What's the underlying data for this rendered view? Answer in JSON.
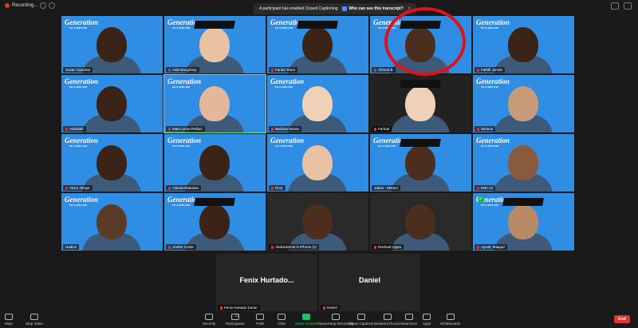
{
  "topbar": {
    "recording_label": "Recording...",
    "notice_text": "A participant has enabled Closed Captioning",
    "notice_link": "Who can see this transcript?"
  },
  "tiles": [
    {
      "name": "Susan Oyedran",
      "mic": false
    },
    {
      "name": "Aida Baugharty",
      "mic": true
    },
    {
      "name": "Farida Toure",
      "mic": true
    },
    {
      "name": "Ahmed B",
      "mic": true
    },
    {
      "name": "Fathifi Jumah",
      "mic": true
    },
    {
      "name": "Abdullah",
      "mic": true
    },
    {
      "name": "Matt Lucas Perfect",
      "mic": true
    },
    {
      "name": "Barbara Moore",
      "mic": true
    },
    {
      "name": "Farhad",
      "mic": true
    },
    {
      "name": "Simeon",
      "mic": true
    },
    {
      "name": "Victor Okoye",
      "mic": true
    },
    {
      "name": "Adeola Babalola",
      "mic": true
    },
    {
      "name": "Rory",
      "mic": true
    },
    {
      "name": "Jabari - Mentor",
      "mic": false
    },
    {
      "name": "Moh Ali",
      "mic": true
    },
    {
      "name": "Hadiza",
      "mic": false
    },
    {
      "name": "Jenifer Corke",
      "mic": true
    },
    {
      "name": "Abdulrahman's iPhone (2)",
      "mic": true
    },
    {
      "name": "Racheal Ugwu",
      "mic": true
    },
    {
      "name": "Ayoub Telaqud",
      "mic": true
    }
  ],
  "logo": {
    "main": "Generation",
    "sub": "UK & IRELAND"
  },
  "big_tiles": [
    {
      "display": "Fenix Hurtado...",
      "name": "Fenix Hurtado Duran"
    },
    {
      "display": "Daniel",
      "name": "Daniel"
    }
  ],
  "toolbar": {
    "mute": "Mute",
    "stop_video": "Stop Video",
    "security": "Security",
    "participants": "Participants",
    "participants_count": "22",
    "polls": "Polls",
    "chat": "Chat",
    "share_screen": "Share Screen",
    "pause_recording": "Pause/Stop Recording",
    "show_captions": "Show Captions",
    "breakout_rooms": "Breakout Rooms",
    "reactions": "Reactions",
    "apps": "Apps",
    "whiteboards": "Whiteboards",
    "end": "End"
  },
  "colors": {
    "tile_bg": "#2f8de4",
    "end_button": "#e0342c",
    "share": "#20c15a",
    "highlight_circle": "#e0111a"
  }
}
